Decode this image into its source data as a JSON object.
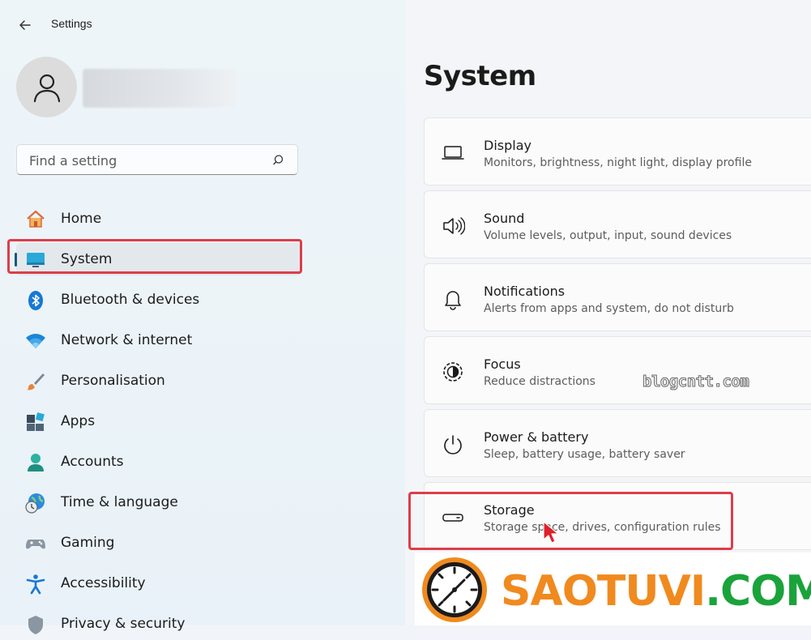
{
  "window": {
    "title": "Settings"
  },
  "search": {
    "placeholder": "Find a setting"
  },
  "nav": {
    "items": [
      {
        "label": "Home",
        "icon": "home-icon"
      },
      {
        "label": "System",
        "icon": "system-monitor-icon",
        "selected": true
      },
      {
        "label": "Bluetooth & devices",
        "icon": "bluetooth-icon"
      },
      {
        "label": "Network & internet",
        "icon": "wifi-icon"
      },
      {
        "label": "Personalisation",
        "icon": "paintbrush-icon"
      },
      {
        "label": "Apps",
        "icon": "apps-icon"
      },
      {
        "label": "Accounts",
        "icon": "accounts-icon"
      },
      {
        "label": "Time & language",
        "icon": "globe-clock-icon"
      },
      {
        "label": "Gaming",
        "icon": "gamepad-icon"
      },
      {
        "label": "Accessibility",
        "icon": "accessibility-icon"
      },
      {
        "label": "Privacy & security",
        "icon": "shield-icon"
      }
    ]
  },
  "main": {
    "title": "System",
    "cards": [
      {
        "title": "Display",
        "subtitle": "Monitors, brightness, night light, display profile",
        "icon": "laptop-icon"
      },
      {
        "title": "Sound",
        "subtitle": "Volume levels, output, input, sound devices",
        "icon": "speaker-icon"
      },
      {
        "title": "Notifications",
        "subtitle": "Alerts from apps and system, do not disturb",
        "icon": "bell-icon"
      },
      {
        "title": "Focus",
        "subtitle": "Reduce distractions",
        "icon": "focus-icon"
      },
      {
        "title": "Power & battery",
        "subtitle": "Sleep, battery usage, battery saver",
        "icon": "power-icon"
      },
      {
        "title": "Storage",
        "subtitle": "Storage space, drives, configuration rules",
        "icon": "storage-drive-icon"
      }
    ]
  },
  "watermark": {
    "text": "blogcntt.com"
  },
  "logo": {
    "part1": "SAOTUVI",
    "part2": ".COM"
  },
  "colors": {
    "highlight_border": "#dc3e4a",
    "selected_indicator": "#145a7a",
    "logo_orange": "#f08a1f",
    "logo_green": "#1aa33a"
  }
}
